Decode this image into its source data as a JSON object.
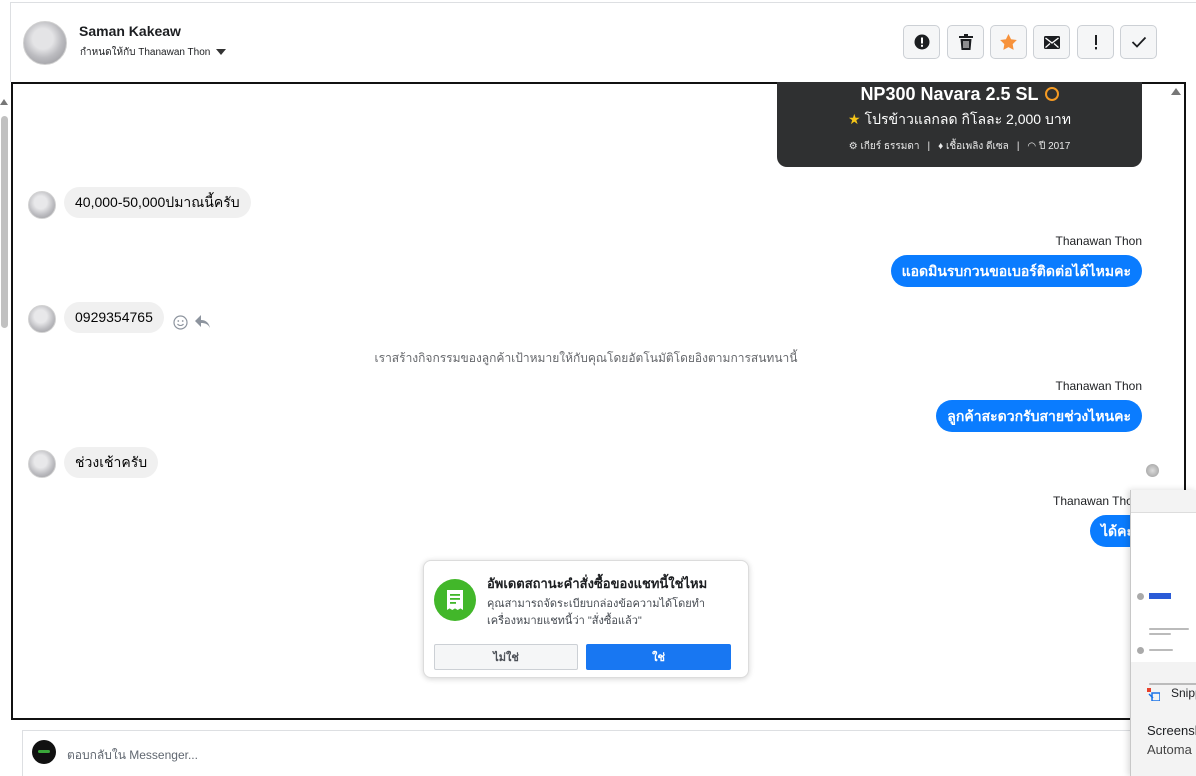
{
  "header": {
    "contact_name": "Saman Kakeaw",
    "assign_label": "กำหนดให้กับ Thanawan Thon",
    "buttons": [
      {
        "name": "mark-spam-button",
        "icon": "alert-circle-icon"
      },
      {
        "name": "delete-button",
        "icon": "trash-icon"
      },
      {
        "name": "star-button",
        "icon": "star-icon",
        "color": "#f7923b"
      },
      {
        "name": "mark-unread-button",
        "icon": "envelope-icon"
      },
      {
        "name": "follow-up-button",
        "icon": "exclamation-icon"
      },
      {
        "name": "mark-done-button",
        "icon": "check-icon"
      }
    ]
  },
  "product_card": {
    "title": "NP300 Navara 2.5 SL",
    "promo": "โปรข้าวแลกลด กิโลละ 2,000 บาท",
    "specs": [
      "เกียร์ ธรรมดา",
      "เชื้อเพลิง ดีเซล",
      "ปี 2017"
    ]
  },
  "messages": {
    "m1": "40,000-50,000ปมาณนี้ครับ",
    "m2_sender": "Thanawan Thon",
    "m2": "แอดมินรบกวนขอเบอร์ติดต่อได้ไหมคะ",
    "m3": "0929354765",
    "system_note": "เราสร้างกิจกรรมของลูกค้าเป้าหมายให้กับคุณโดยอัตโนมัติโดยอิงตามการสนทนานี้",
    "m4_sender": "Thanawan Thon",
    "m4": "ลูกค้าสะดวกรับสายช่วงไหนคะ",
    "m5": "ช่วงเช้าครับ",
    "m6_sender": "Thanawan Thon",
    "m6": "ได้คะ"
  },
  "popup": {
    "title": "อัพเดตสถานะคำสั่งซื้อของแชทนี้ใช่ไหม",
    "body": "คุณสามารถจัดระเบียบกล่องข้อความได้โดยทำเครื่องหมายแชทนี้ว่า \"สั่งซื้อแล้ว\"",
    "no_label": "ไม่ใช่",
    "yes_label": "ใช่",
    "accent": "#42b72a"
  },
  "reply": {
    "placeholder": "ตอบกลับใน Messenger..."
  },
  "snip_overlay": {
    "app_name": "Snipp",
    "title": "Screensh",
    "subtitle": "Automa"
  },
  "colors": {
    "outgoing_bubble": "#0a7cff",
    "incoming_bubble": "#f0f0f0",
    "primary_button": "#1877f2"
  }
}
